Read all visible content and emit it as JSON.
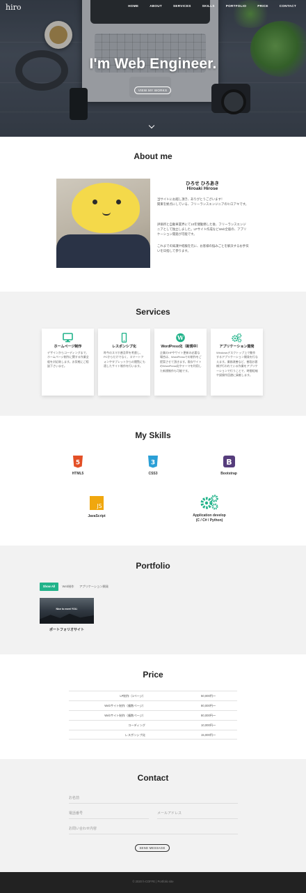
{
  "header": {
    "logo": "hiro",
    "menu": [
      "HOME",
      "ABOUT",
      "SERVICES",
      "SKILLS",
      "PORTFOLIO",
      "PRICE",
      "CONTACT"
    ]
  },
  "hero": {
    "title": "I'm Web Engineer.",
    "button": "VIEW MY WORKS"
  },
  "about": {
    "title": "About me",
    "name_kana": "ひろせ ひろあき",
    "name_en": "Hiroaki Hirose",
    "paragraphs": [
      "当サイトにお越し頂き、ありがとうございます！",
      "関東を拠点にしている、フリーランスエンジニアのヒロアキです。",
      "評価所と自動車業界にて10年間勤務した後、フリーランスエンジニアとして独立しました。LPサイト作成などWeb全般の、アプリケーション開発が可能です。",
      "これまでの知識や経験を元に、お客様の悩みごとを解決するお手伝いを日指して参ります。"
    ]
  },
  "services": {
    "title": "Services",
    "items": [
      {
        "icon": "monitor-icon",
        "title": "ホームページ制作",
        "desc": "デザインからコーディングまで、ホームページ制作に関する作業全般を対応致します。お気軽にご相談下さいませ。"
      },
      {
        "icon": "smartphone-icon",
        "title": "レスポンシブ化",
        "desc": "昨今のスマホ普及率を考慮し、PCからだけでなく、スマートフォンやタブレットからの閲覧にも適したサイト制作を行います。"
      },
      {
        "icon": "wordpress-icon",
        "title": "WordPress化（新規中）",
        "desc": "企業のHPやサイト更新の必要な場合は、WordPressでの制作をご提案させて頂きます。既存サイトのWordPress化やテーマを利用した新規制作も可能です。"
      },
      {
        "icon": "gears-icon",
        "title": "アプリケーション開発",
        "desc": "Windowsデスクトップ上で動作するアプリケーション開発を行なえます。業務改善など、普段お客様が行われている作業をアプリケーションで行うことで、時間短縮や誤操作回避に貢献します。"
      }
    ]
  },
  "skills": {
    "title": "My Skills",
    "items": [
      {
        "icon": "html5-icon",
        "label": "HTML5"
      },
      {
        "icon": "css3-icon",
        "label": "CSS3"
      },
      {
        "icon": "bootstrap-icon",
        "label": "Bootstrap"
      },
      {
        "icon": "javascript-icon",
        "label": "JavaScript"
      },
      {
        "icon": "gears-icon",
        "label": "Application develop",
        "label2": "(C / C# / Python)"
      }
    ]
  },
  "portfolio": {
    "title": "Portfolio",
    "tabs": [
      "Show All",
      "Web制作",
      "アプリケーション開発"
    ],
    "items": [
      {
        "thumb_text": "Nice to meet YOU.",
        "caption": "ポートフォリオサイト"
      }
    ]
  },
  "price": {
    "title": "Price",
    "rows": [
      {
        "name": "LP制作（1ページ）",
        "value": "50,000円〜"
      },
      {
        "name": "Webサイト制作（複数ページ）",
        "value": "80,000円〜"
      },
      {
        "name": "Webサイト制作（複数ページ）",
        "value": "80,000円〜"
      },
      {
        "name": "コーディング",
        "value": "10,000円〜"
      },
      {
        "name": "レスポンシブ化",
        "value": "15,000円〜"
      }
    ]
  },
  "contact": {
    "title": "Contact",
    "name_placeholder": "お名前",
    "phone_placeholder": "電話番号",
    "email_placeholder": "メールアドレス",
    "message_placeholder": "お問い合わせ内容",
    "button": "SEND MESSAGE"
  },
  "footer": {
    "copyright": "© 2020 h-COFFE | Portfolio site"
  },
  "colors": {
    "accent": "#21b38a",
    "html5": "#e34f26",
    "css3": "#2a9fd6",
    "bootstrap": "#563d7c",
    "javascript": "#f0a70e",
    "footer": "#222222"
  }
}
